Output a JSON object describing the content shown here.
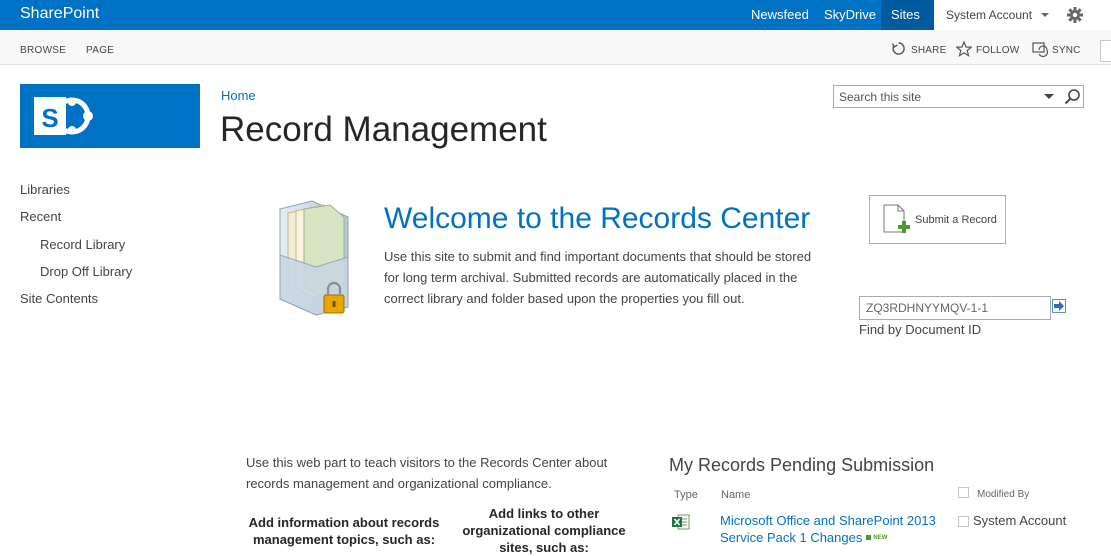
{
  "suite_bar": {
    "brand": "SharePoint",
    "links": [
      "Newsfeed",
      "SkyDrive"
    ],
    "active_link": "Sites",
    "account": "System Account",
    "accent_color": "#0072c6"
  },
  "ribbon": {
    "tabs": [
      "BROWSE",
      "PAGE"
    ],
    "actions": {
      "share": "SHARE",
      "follow": "FOLLOW",
      "sync": "SYNC"
    }
  },
  "header": {
    "breadcrumb": "Home",
    "title": "Record Management",
    "search_placeholder": "Search this site"
  },
  "nav": {
    "items": [
      {
        "label": "Libraries"
      },
      {
        "label": "Recent"
      },
      {
        "label": "Record Library"
      },
      {
        "label": "Drop Off Library"
      },
      {
        "label": "Site Contents"
      }
    ]
  },
  "welcome": {
    "title": "Welcome to the Records Center",
    "text": "Use this site to submit and find important documents that should be stored for long term archival. Submitted records are automatically placed in the correct library and folder based upon the properties you fill out."
  },
  "submit": {
    "label": "Submit a Record"
  },
  "doc_id": {
    "value": "ZQ3RDHNYYMQV-1-1",
    "label": "Find by Document ID"
  },
  "teach": {
    "text": "Use this web part to teach visitors to the Records Center about records management and organizational compliance.",
    "col1": "Add information about records management topics, such as:",
    "col2": "Add links to other organizational compliance sites, such as:"
  },
  "pending": {
    "title": "My Records Pending Submission",
    "columns": {
      "type": "Type",
      "name": "Name",
      "modified_by": "Modified By"
    },
    "rows": [
      {
        "type_icon": "excel-file-icon",
        "name": "Microsoft Office and SharePoint 2013 Service Pack 1 Changes",
        "badge": "NEW",
        "modified_by": "System Account"
      }
    ]
  }
}
